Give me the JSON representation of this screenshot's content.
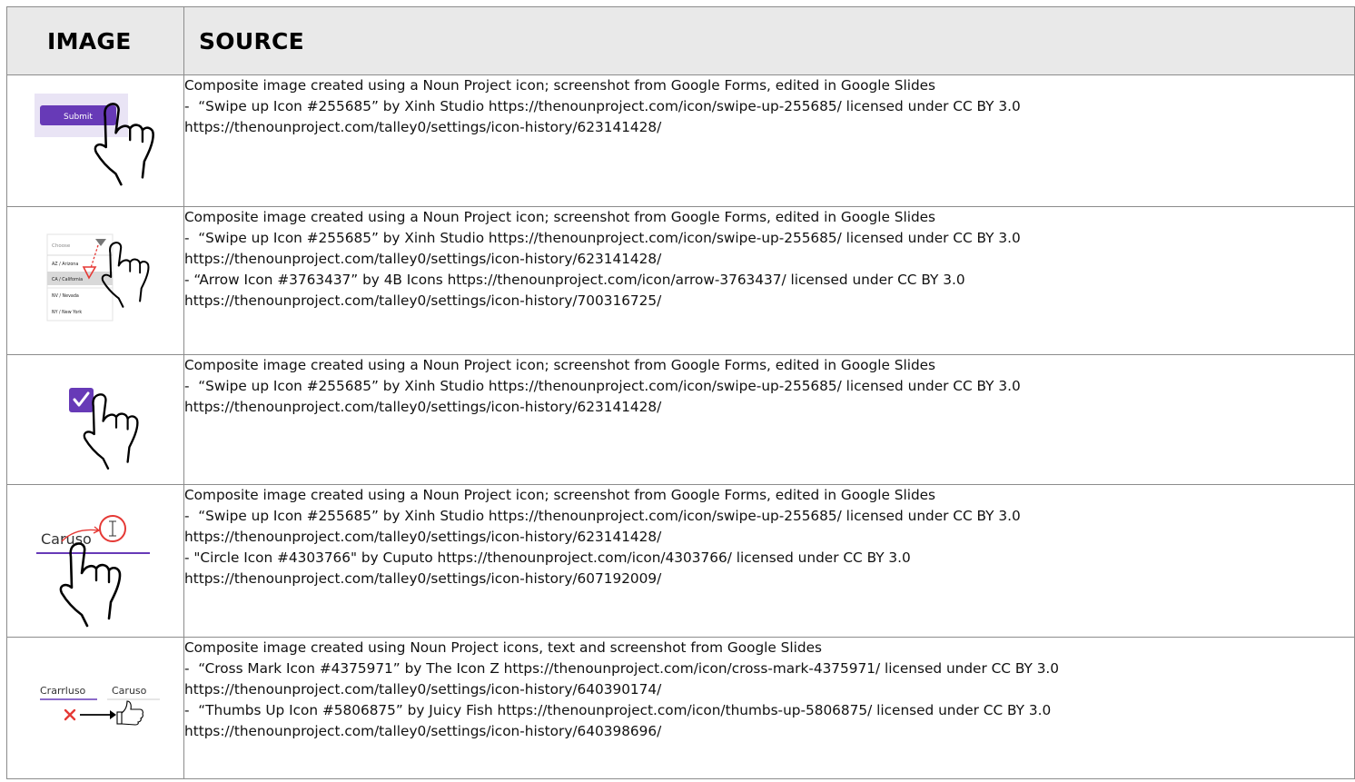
{
  "table": {
    "headers": {
      "image": "IMAGE",
      "source": "SOURCE"
    },
    "rows": [
      {
        "thumbnail": {
          "description_icon": "submit-button-tap",
          "button_label": "Submit",
          "accent": "#673ab7"
        },
        "lines": [
          "Composite image created using a Noun Project icon; screenshot from Google Forms, edited in Google Slides",
          "-  “Swipe up Icon #255685” by Xinh Studio https://thenounproject.com/icon/swipe-up-255685/ licensed under CC BY 3.0",
          "https://thenounproject.com/talley0/settings/icon-history/623141428/"
        ]
      },
      {
        "thumbnail": {
          "placeholder": "Choose",
          "options": [
            "AZ / Arizona",
            "CA / California",
            "NV / Nevada",
            "NY / New York"
          ],
          "accent": "#e53935"
        },
        "lines": [
          "Composite image created using a Noun Project icon; screenshot from Google Forms, edited in Google Slides",
          "-  “Swipe up Icon #255685” by Xinh Studio https://thenounproject.com/icon/swipe-up-255685/ licensed under CC BY 3.0",
          "https://thenounproject.com/talley0/settings/icon-history/623141428/",
          "- “Arrow Icon #3763437” by 4B Icons https://thenounproject.com/icon/arrow-3763437/ licensed under CC BY 3.0",
          "https://thenounproject.com/talley0/settings/icon-history/700316725/"
        ]
      },
      {
        "thumbnail": {
          "icon": "checkbox-checked-icon",
          "accent": "#673ab7"
        },
        "lines": [
          "Composite image created using a Noun Project icon; screenshot from Google Forms, edited in Google Slides",
          "-  “Swipe up Icon #255685” by Xinh Studio https://thenounproject.com/icon/swipe-up-255685/ licensed under CC BY 3.0",
          "https://thenounproject.com/talley0/settings/icon-history/623141428/"
        ]
      },
      {
        "thumbnail": {
          "word": "Caruso",
          "accent": "#673ab7",
          "circle_color": "#e53935"
        },
        "lines": [
          "Composite image created using a Noun Project icon; screenshot from Google Forms, edited in Google Slides",
          "-  “Swipe up Icon #255685” by Xinh Studio https://thenounproject.com/icon/swipe-up-255685/ licensed under CC BY 3.0",
          "https://thenounproject.com/talley0/settings/icon-history/623141428/",
          "- \"Circle Icon #4303766\" by Cuputo https://thenounproject.com/icon/4303766/ licensed under CC BY 3.0",
          "https://thenounproject.com/talley0/settings/icon-history/607192009/"
        ]
      },
      {
        "thumbnail": {
          "wrong_word": "Crarrluso",
          "right_word": "Caruso",
          "accent": "#673ab7",
          "cross_color": "#e53935"
        },
        "lines": [
          "Composite image created using Noun Project icons, text and screenshot from Google Slides",
          "-  “Cross Mark Icon #4375971” by The Icon Z https://thenounproject.com/icon/cross-mark-4375971/ licensed under CC BY 3.0",
          "https://thenounproject.com/talley0/settings/icon-history/640390174/",
          "-  “Thumbs Up Icon #5806875” by Juicy Fish https://thenounproject.com/icon/thumbs-up-5806875/ licensed under CC BY 3.0",
          "https://thenounproject.com/talley0/settings/icon-history/640398696/"
        ]
      }
    ]
  }
}
